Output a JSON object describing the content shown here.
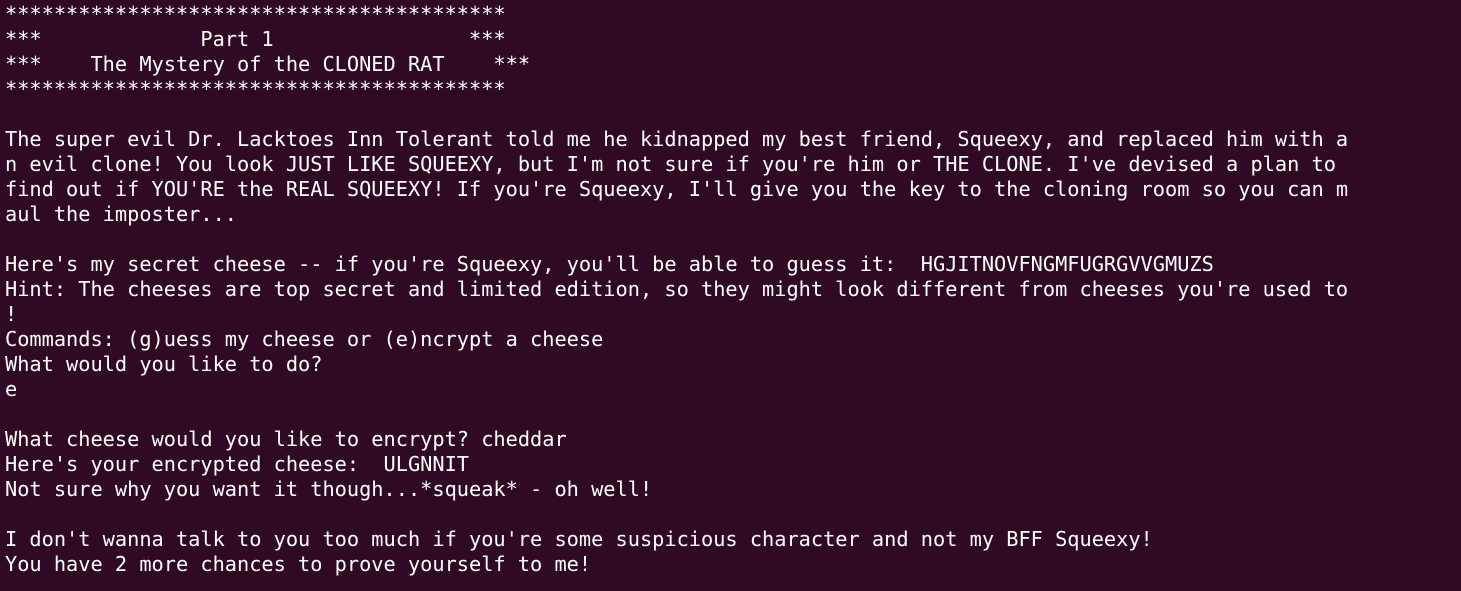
{
  "terminal": {
    "lines": [
      "*****************************************",
      "***             Part 1                ***",
      "***    The Mystery of the CLONED RAT    ***",
      "*****************************************",
      "",
      "The super evil Dr. Lacktoes Inn Tolerant told me he kidnapped my best friend, Squeexy, and replaced him with a",
      "n evil clone! You look JUST LIKE SQUEEXY, but I'm not sure if you're him or THE CLONE. I've devised a plan to",
      "find out if YOU'RE the REAL SQUEEXY! If you're Squeexy, I'll give you the key to the cloning room so you can m",
      "aul the imposter...",
      "",
      "Here's my secret cheese -- if you're Squeexy, you'll be able to guess it:  HGJITNOVFNGMFUGRGVVGMUZS",
      "Hint: The cheeses are top secret and limited edition, so they might look different from cheeses you're used to",
      "!",
      "Commands: (g)uess my cheese or (e)ncrypt a cheese",
      "What would you like to do?",
      "e",
      "",
      "What cheese would you like to encrypt? cheddar",
      "Here's your encrypted cheese:  ULGNNIT",
      "Not sure why you want it though...*squeak* - oh well!",
      "",
      "I don't wanna talk to you too much if you're some suspicious character and not my BFF Squeexy!",
      "You have 2 more chances to prove yourself to me!"
    ]
  }
}
